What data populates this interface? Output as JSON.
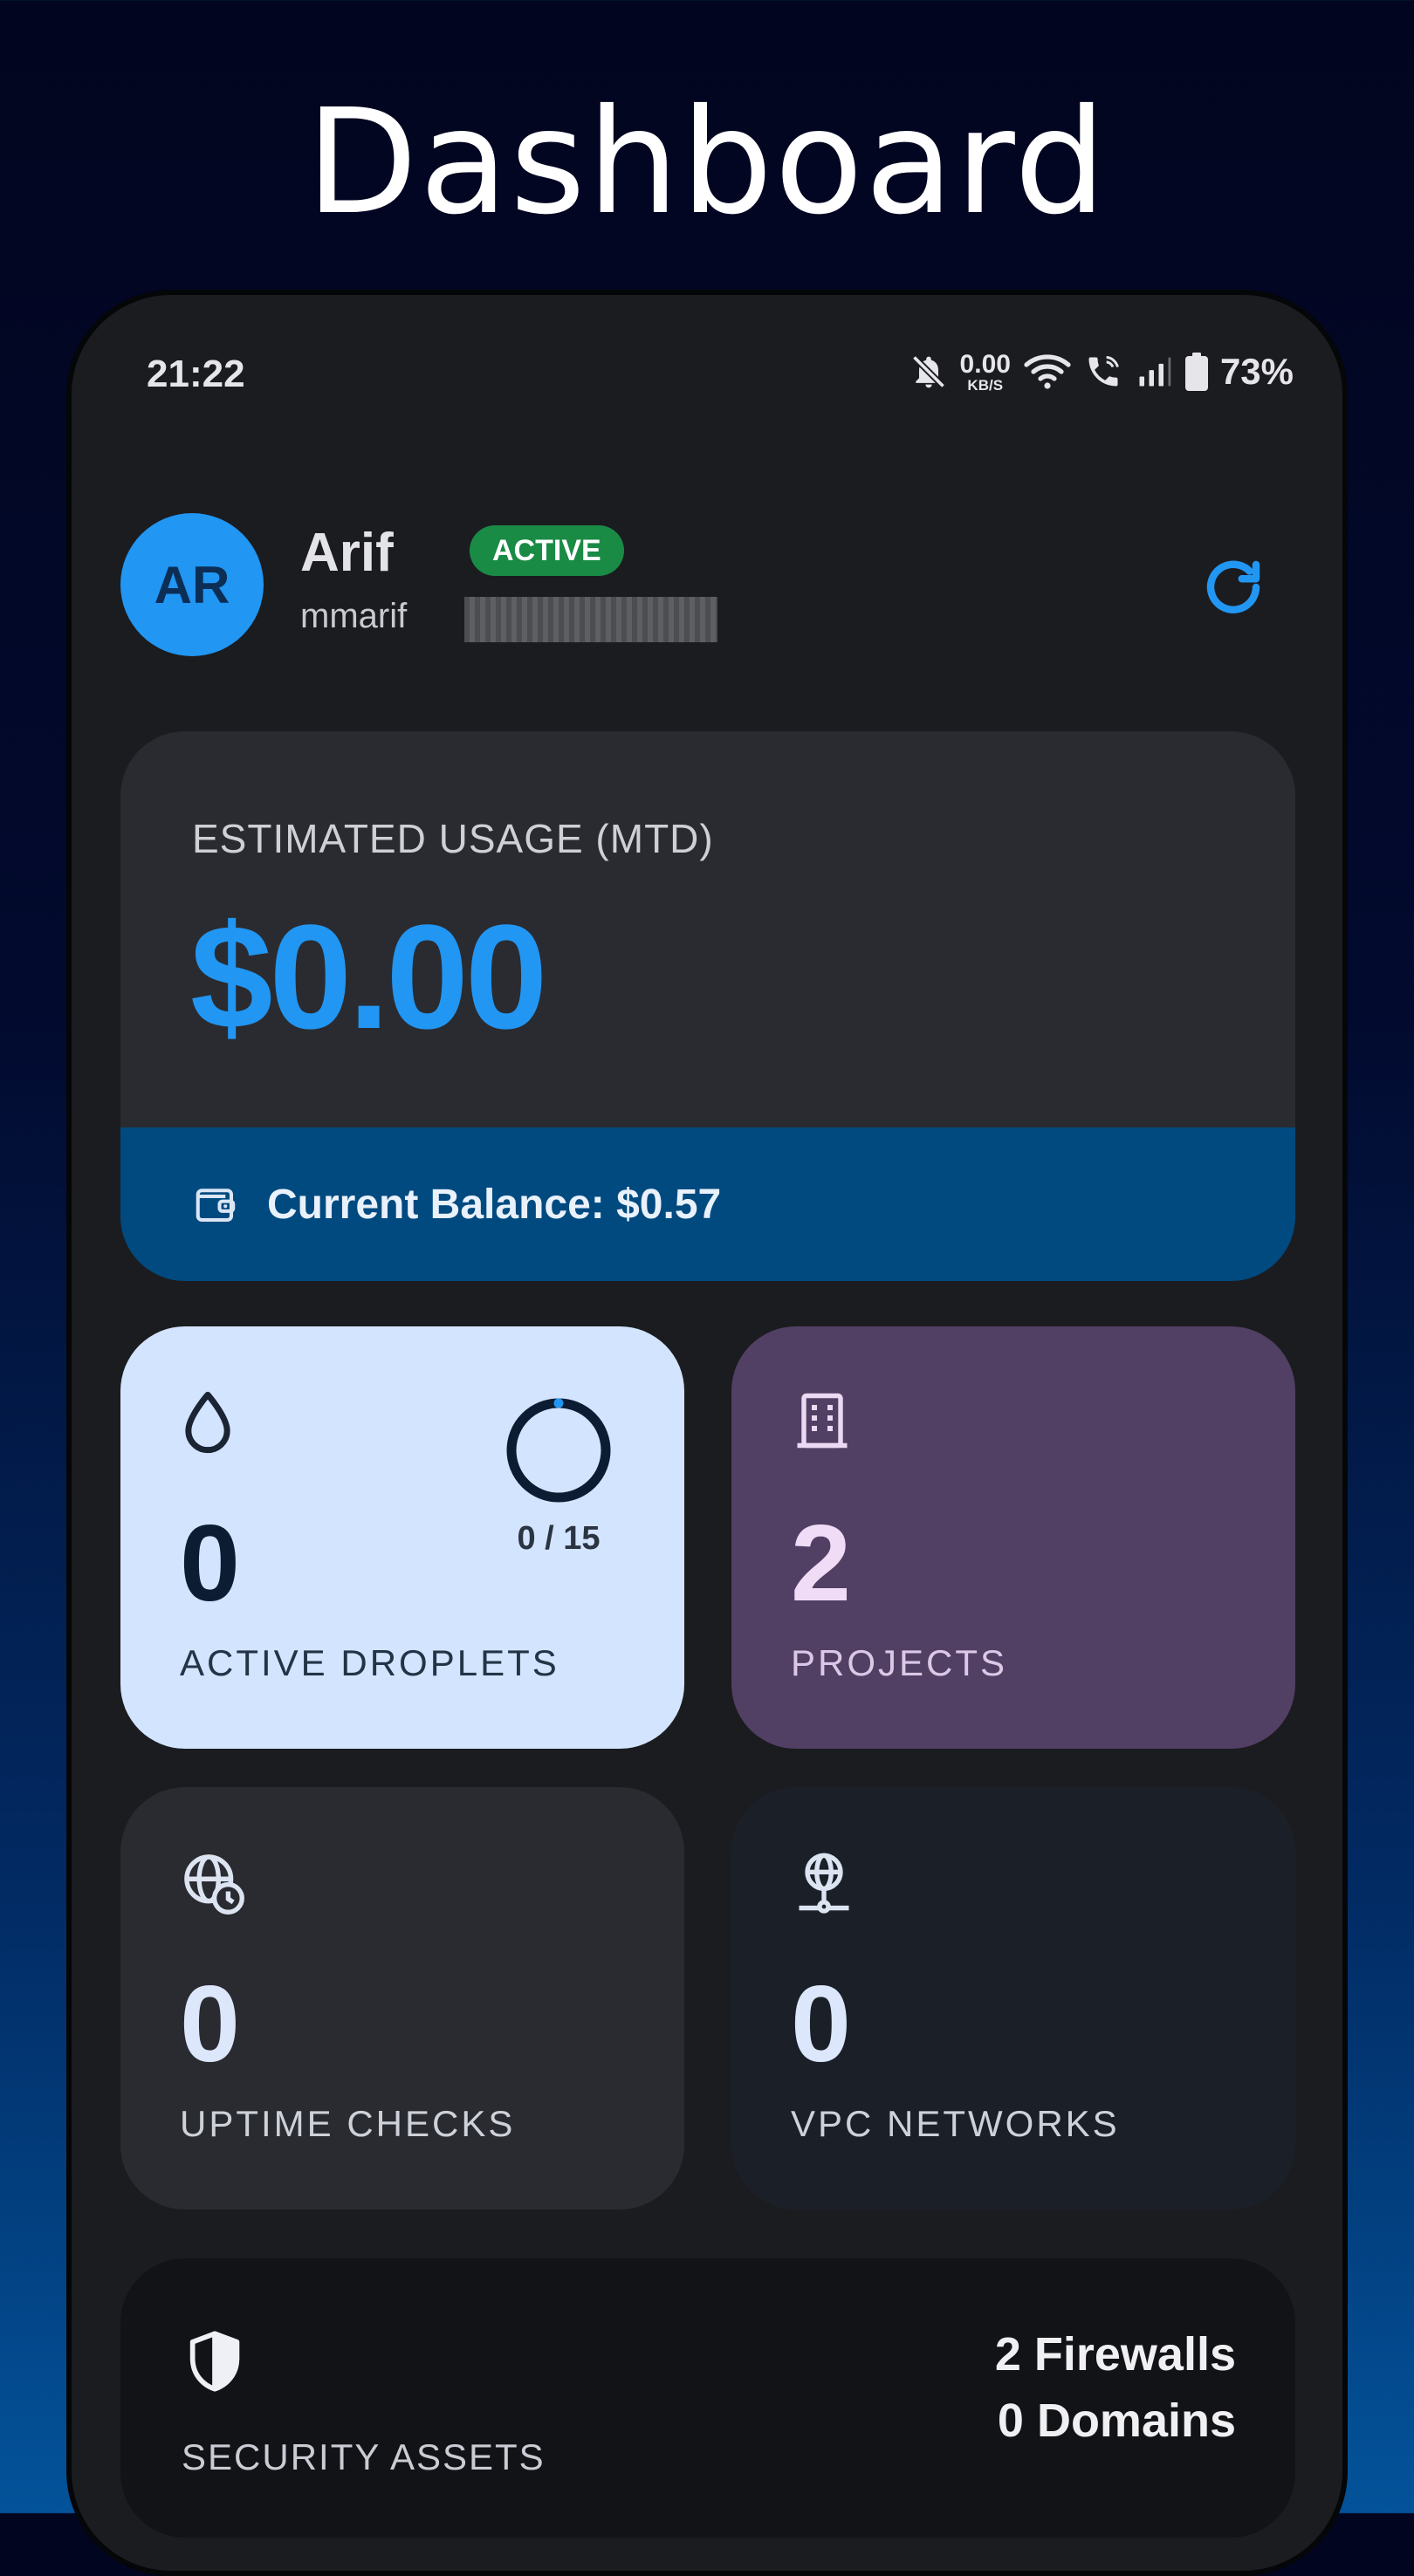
{
  "headline": "Dashboard",
  "status_bar": {
    "time": "21:22",
    "net_speed_value": "0.00",
    "net_speed_unit": "KB/S",
    "battery": "73%",
    "icons": [
      "bell-off-icon",
      "wifi-icon",
      "wifi-call-icon",
      "signal-icon",
      "battery-icon"
    ]
  },
  "profile": {
    "initials": "AR",
    "name": "Arif",
    "status": "ACTIVE",
    "email_visible": "mmarif",
    "avatar_color": "#2196f3"
  },
  "usage": {
    "label": "ESTIMATED USAGE (MTD)",
    "value": "$0.00",
    "balance": "Current Balance: $0.57"
  },
  "tiles": {
    "droplets": {
      "count": "0",
      "label": "ACTIVE DROPLETS",
      "ratio": "0 / 15",
      "used": 0,
      "limit": 15
    },
    "projects": {
      "count": "2",
      "label": "PROJECTS"
    },
    "uptime": {
      "count": "0",
      "label": "UPTIME CHECKS"
    },
    "vpc": {
      "count": "0",
      "label": "VPC NETWORKS"
    }
  },
  "security": {
    "label": "SECURITY ASSETS",
    "firewalls": "2 Firewalls",
    "domains": "0 Domains"
  },
  "colors": {
    "accent": "#2196f3",
    "active_badge": "#1a8b45",
    "balance_bar": "#004a80",
    "droplet_tile": "#d3e4fe",
    "projects_tile": "#523f64"
  }
}
